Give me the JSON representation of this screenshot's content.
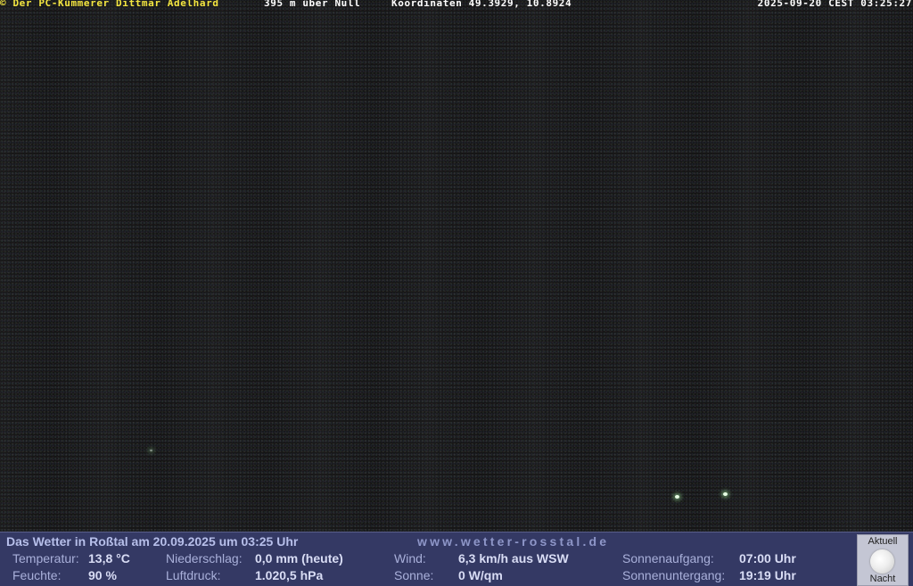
{
  "overlay": {
    "copyright": "© Der PC-Kümmerer Dittmar Adelhard",
    "altitude": "395 m über Null",
    "coordinates": "Koordinaten 49.3929, 10.8924",
    "datetime": "2025-09-20 CEST 03:25:27"
  },
  "weather": {
    "title": "Das Wetter in Roßtal am 20.09.2025 um 03:25 Uhr",
    "website": "www.wetter-rosstal.de",
    "temperature_label": "Temperatur:",
    "temperature_value": "13,8 °C",
    "humidity_label": "Feuchte:",
    "humidity_value": "90 %",
    "precip_label": "Niederschlag:",
    "precip_value": "0,0 mm (heute)",
    "pressure_label": "Luftdruck:",
    "pressure_value": "1.020,5 hPa",
    "wind_label": "Wind:",
    "wind_value": "6,3 km/h aus WSW",
    "sun_label": "Sonne:",
    "sun_value": "0 W/qm",
    "sunrise_label": "Sonnenaufgang:",
    "sunrise_value": "07:00 Uhr",
    "sunset_label": "Sonnenuntergang:",
    "sunset_value": "19:19 Uhr"
  },
  "moon": {
    "top_label": "Aktuell",
    "bottom_label": "Nacht",
    "icon": "full-moon-icon"
  }
}
